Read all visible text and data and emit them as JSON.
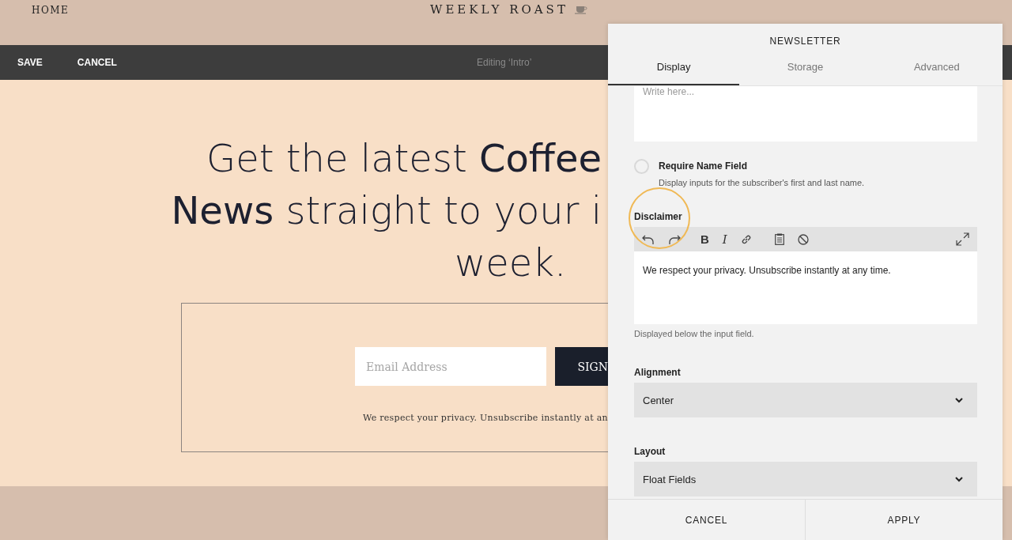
{
  "site_header": {
    "nav_link": "HOME",
    "logo": "WEEKLY ROAST"
  },
  "edit_bar": {
    "buttons": [
      "SAVE",
      "CANCEL"
    ],
    "status": "Editing ‘Intro’"
  },
  "hero": {
    "lines": [
      "Get the latest **Coffee**",
      "**News** straight to your i",
      "week."
    ]
  },
  "signup_form": {
    "email_placeholder": "Email Address",
    "submit_button": "SIGN",
    "disclaimer": "We respect your privacy. Unsubscribe instantly at an"
  },
  "panel": {
    "title": "NEWSLETTER",
    "tabs": [
      {
        "label": "Display",
        "selected": true
      },
      {
        "label": "Storage",
        "selected": false
      },
      {
        "label": "Advanced",
        "selected": false
      }
    ],
    "message_field": {
      "placeholder": "Write here..."
    },
    "require_name": {
      "label": "Require Name Field",
      "description": "Display inputs for the subscriber's first and last name.",
      "checked": false
    },
    "disclaimer": {
      "label": "Disclaimer",
      "toolbar": [
        {
          "kind": "undo"
        },
        {
          "kind": "redo"
        },
        {
          "kind": "bold",
          "label": "B"
        },
        {
          "kind": "italic",
          "label": "I"
        },
        {
          "kind": "link"
        },
        {
          "kind": "paste"
        },
        {
          "kind": "clear"
        },
        {
          "kind": "expand"
        }
      ],
      "value": "We respect your privacy. Unsubscribe instantly at any time.",
      "help": "Displayed below the input field."
    },
    "selects": [
      {
        "label": "Alignment",
        "value": "Center"
      },
      {
        "label": "Layout",
        "value": "Float Fields"
      }
    ],
    "footer_buttons": [
      "CANCEL",
      "APPLY"
    ]
  }
}
